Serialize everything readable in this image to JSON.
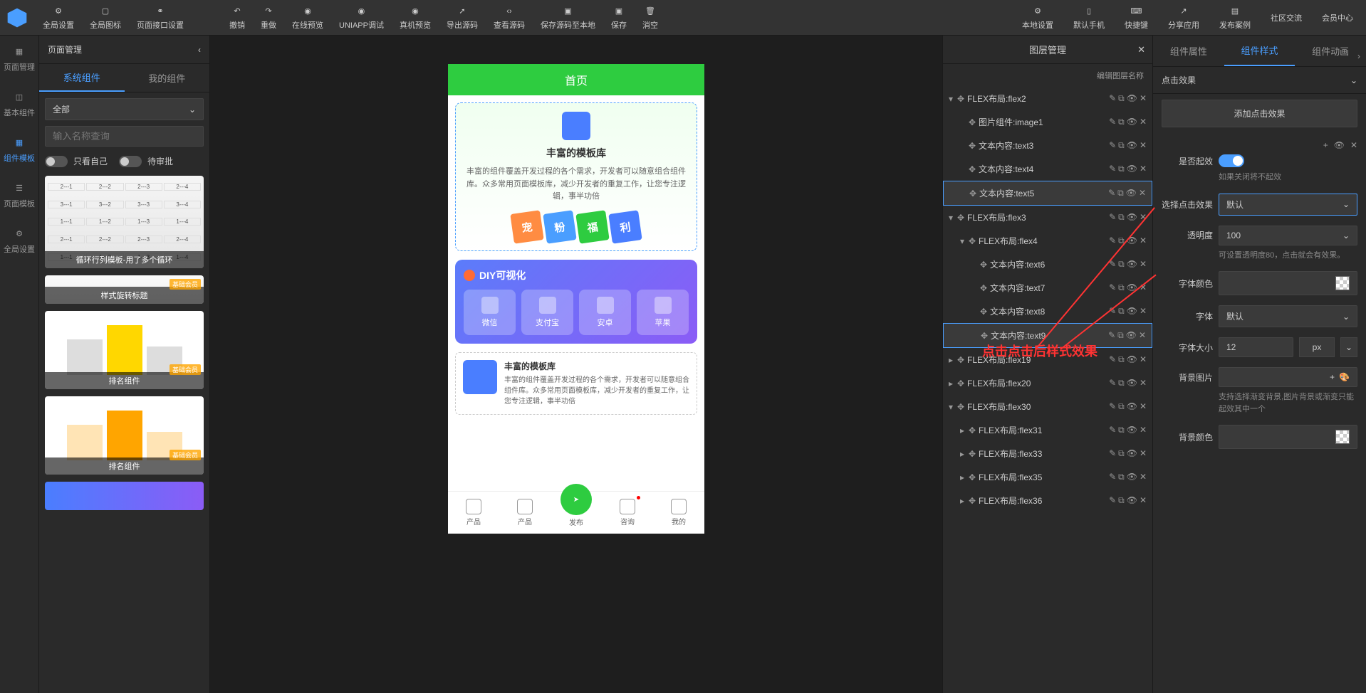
{
  "toolbar": {
    "items": [
      {
        "label": "全局设置"
      },
      {
        "label": "全局图标"
      },
      {
        "label": "页面接口设置"
      }
    ],
    "center": [
      {
        "label": "撤销"
      },
      {
        "label": "重做"
      },
      {
        "label": "在线预览"
      },
      {
        "label": "UNIAPP调试"
      },
      {
        "label": "真机预览"
      },
      {
        "label": "导出源码"
      },
      {
        "label": "查看源码"
      },
      {
        "label": "保存源码至本地"
      },
      {
        "label": "保存"
      },
      {
        "label": "消空"
      }
    ],
    "right": [
      {
        "label": "本地设置"
      },
      {
        "label": "默认手机"
      },
      {
        "label": "快捷键"
      },
      {
        "label": "分享应用"
      },
      {
        "label": "发布案例"
      },
      {
        "label": "社区交流"
      },
      {
        "label": "会员中心"
      }
    ]
  },
  "page_header": "页面管理",
  "left_sidebar": [
    {
      "label": "页面管理"
    },
    {
      "label": "基本组件"
    },
    {
      "label": "组件模板"
    },
    {
      "label": "页面模板"
    },
    {
      "label": "全局设置"
    }
  ],
  "comp_tabs": [
    "系统组件",
    "我的组件"
  ],
  "filter_all": "全部",
  "search_placeholder": "输入名称查询",
  "toggle_self": "只看自己",
  "toggle_approve": "待审批",
  "templates": [
    {
      "label": "循环行列模板-用了多个循环",
      "badge": ""
    },
    {
      "label": "样式旋转标题",
      "badge": "基础会员"
    },
    {
      "label": "排名组件",
      "badge": "基础会员"
    },
    {
      "label": "排名组件",
      "badge": "基础会员"
    }
  ],
  "phone": {
    "title": "首页",
    "card1_title": "丰富的模板库",
    "card1_desc": "丰富的组件覆盖开发过程的各个需求，开发者可以随意组合组件库。众多常用页面模板库，减少开发者的重复工作，让您专注逻辑，事半功倍",
    "diamonds": [
      "宠",
      "粉",
      "福",
      "利"
    ],
    "diy_title": "DIY可视化",
    "diy_items": [
      "微信",
      "支付宝",
      "安卓",
      "苹果"
    ],
    "card2_title": "丰富的模板库",
    "card2_desc": "丰富的组件覆盖开发过程的各个需求，开发者可以随意组合组件库。众多常用页面模板库，减少开发者的重复工作，让您专注逻辑，事半功倍",
    "tabs": [
      "产品",
      "产品",
      "发布",
      "咨询",
      "我的"
    ]
  },
  "layers": {
    "title": "图层管理",
    "subtitle": "编辑图层名称",
    "items": [
      {
        "indent": 0,
        "expand": "▾",
        "name": "FLEX布局:flex2"
      },
      {
        "indent": 1,
        "expand": "",
        "name": "图片组件:image1"
      },
      {
        "indent": 1,
        "expand": "",
        "name": "文本内容:text3"
      },
      {
        "indent": 1,
        "expand": "",
        "name": "文本内容:text4"
      },
      {
        "indent": 1,
        "expand": "",
        "name": "文本内容:text5",
        "selected": true
      },
      {
        "indent": 0,
        "expand": "▾",
        "name": "FLEX布局:flex3"
      },
      {
        "indent": 1,
        "expand": "▾",
        "name": "FLEX布局:flex4"
      },
      {
        "indent": 2,
        "expand": "",
        "name": "文本内容:text6"
      },
      {
        "indent": 2,
        "expand": "",
        "name": "文本内容:text7"
      },
      {
        "indent": 2,
        "expand": "",
        "name": "文本内容:text8"
      },
      {
        "indent": 2,
        "expand": "",
        "name": "文本内容:text9",
        "selected": true
      },
      {
        "indent": 0,
        "expand": "▸",
        "name": "FLEX布局:flex19"
      },
      {
        "indent": 0,
        "expand": "▸",
        "name": "FLEX布局:flex20"
      },
      {
        "indent": 0,
        "expand": "▾",
        "name": "FLEX布局:flex30"
      },
      {
        "indent": 1,
        "expand": "▸",
        "name": "FLEX布局:flex31"
      },
      {
        "indent": 1,
        "expand": "▸",
        "name": "FLEX布局:flex33"
      },
      {
        "indent": 1,
        "expand": "▸",
        "name": "FLEX布局:flex35"
      },
      {
        "indent": 1,
        "expand": "▸",
        "name": "FLEX布局:flex36"
      }
    ]
  },
  "annotation": "点击点击后样式效果",
  "props": {
    "tabs": [
      "组件属性",
      "组件样式",
      "组件动画"
    ],
    "section": "点击效果",
    "add_btn": "添加点击效果",
    "enable_label": "是否起效",
    "enable_hint": "如果关闭将不起效",
    "select_label": "选择点击效果",
    "select_value": "默认",
    "opacity_label": "透明度",
    "opacity_value": "100",
    "opacity_hint": "可设置透明度80，点击就会有效果。",
    "font_color_label": "字体颜色",
    "font_label": "字体",
    "font_value": "默认",
    "font_size_label": "字体大小",
    "font_size_value": "12",
    "font_size_unit": "px",
    "bg_image_label": "背景图片",
    "bg_image_hint": "支持选择渐变背景,图片背景或渐变只能起效其中一个",
    "bg_color_label": "背景颜色"
  }
}
